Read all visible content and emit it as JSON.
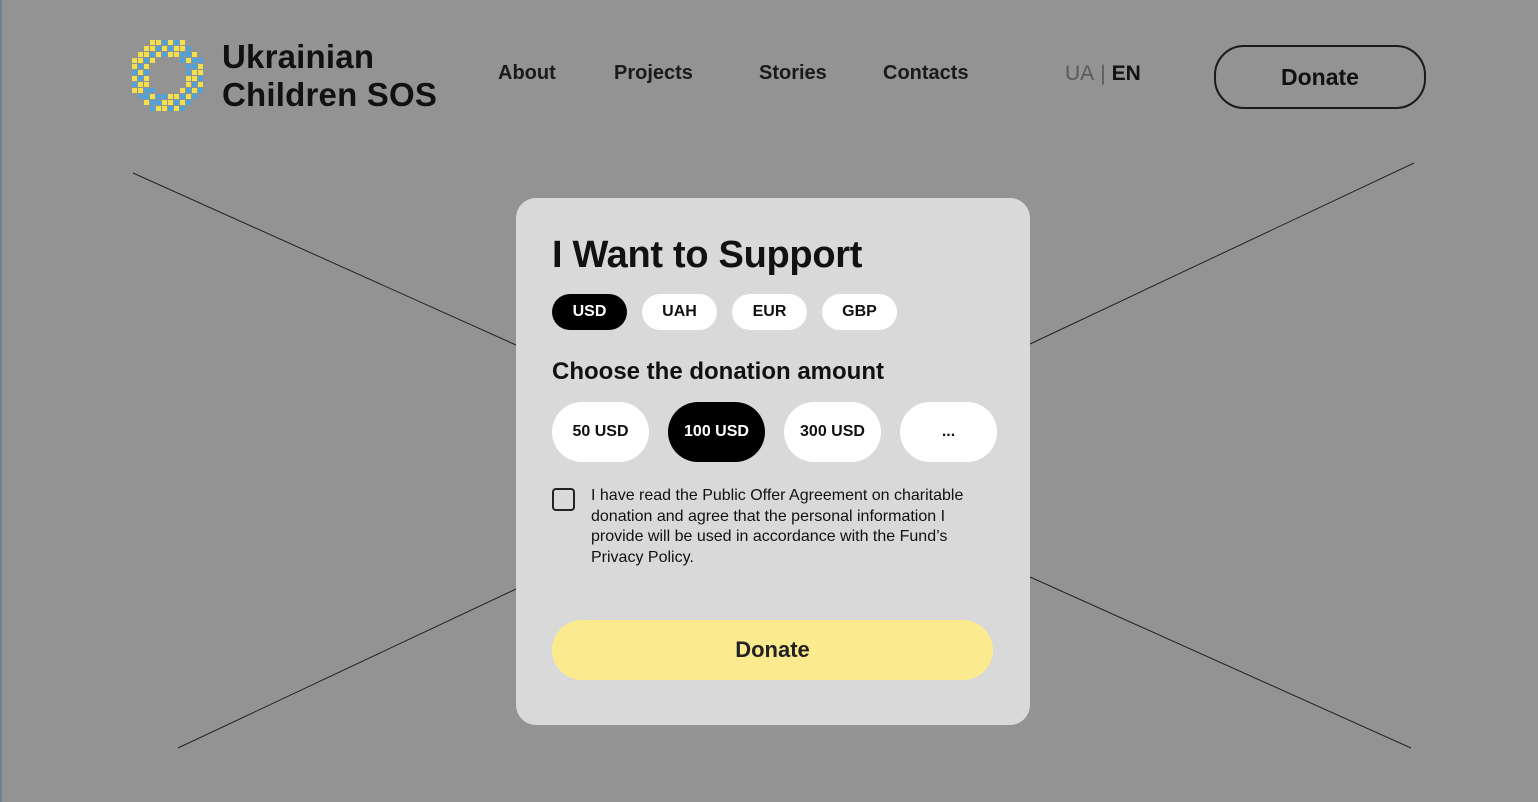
{
  "brand": {
    "line1": "Ukrainian",
    "line2": "Children SOS",
    "colors": {
      "blue": "#4fa3dc",
      "yellow": "#f4e04d"
    }
  },
  "nav": {
    "items": [
      {
        "label": "About"
      },
      {
        "label": "Projects"
      },
      {
        "label": "Stories"
      },
      {
        "label": "Contacts"
      }
    ]
  },
  "lang": {
    "ua": "UA",
    "separator": "|",
    "en": "EN",
    "active": "EN"
  },
  "header": {
    "donate_label": "Donate"
  },
  "modal": {
    "title": "I Want to Support",
    "currencies": [
      {
        "label": "USD",
        "selected": true
      },
      {
        "label": "UAH",
        "selected": false
      },
      {
        "label": "EUR",
        "selected": false
      },
      {
        "label": "GBP",
        "selected": false
      }
    ],
    "amount_heading": "Choose the donation amount",
    "amounts": [
      {
        "label": "50 USD",
        "selected": false
      },
      {
        "label": "100 USD",
        "selected": true
      },
      {
        "label": "300 USD",
        "selected": false
      },
      {
        "label": "...",
        "selected": false
      }
    ],
    "agreement": {
      "checked": false,
      "text": "I have read the Public Offer Agreement on charitable donation and agree that the personal information I provide will be used in accordance with the Fund’s Privacy Policy."
    },
    "donate_label": "Donate",
    "donate_color": "#fbeb8e"
  }
}
